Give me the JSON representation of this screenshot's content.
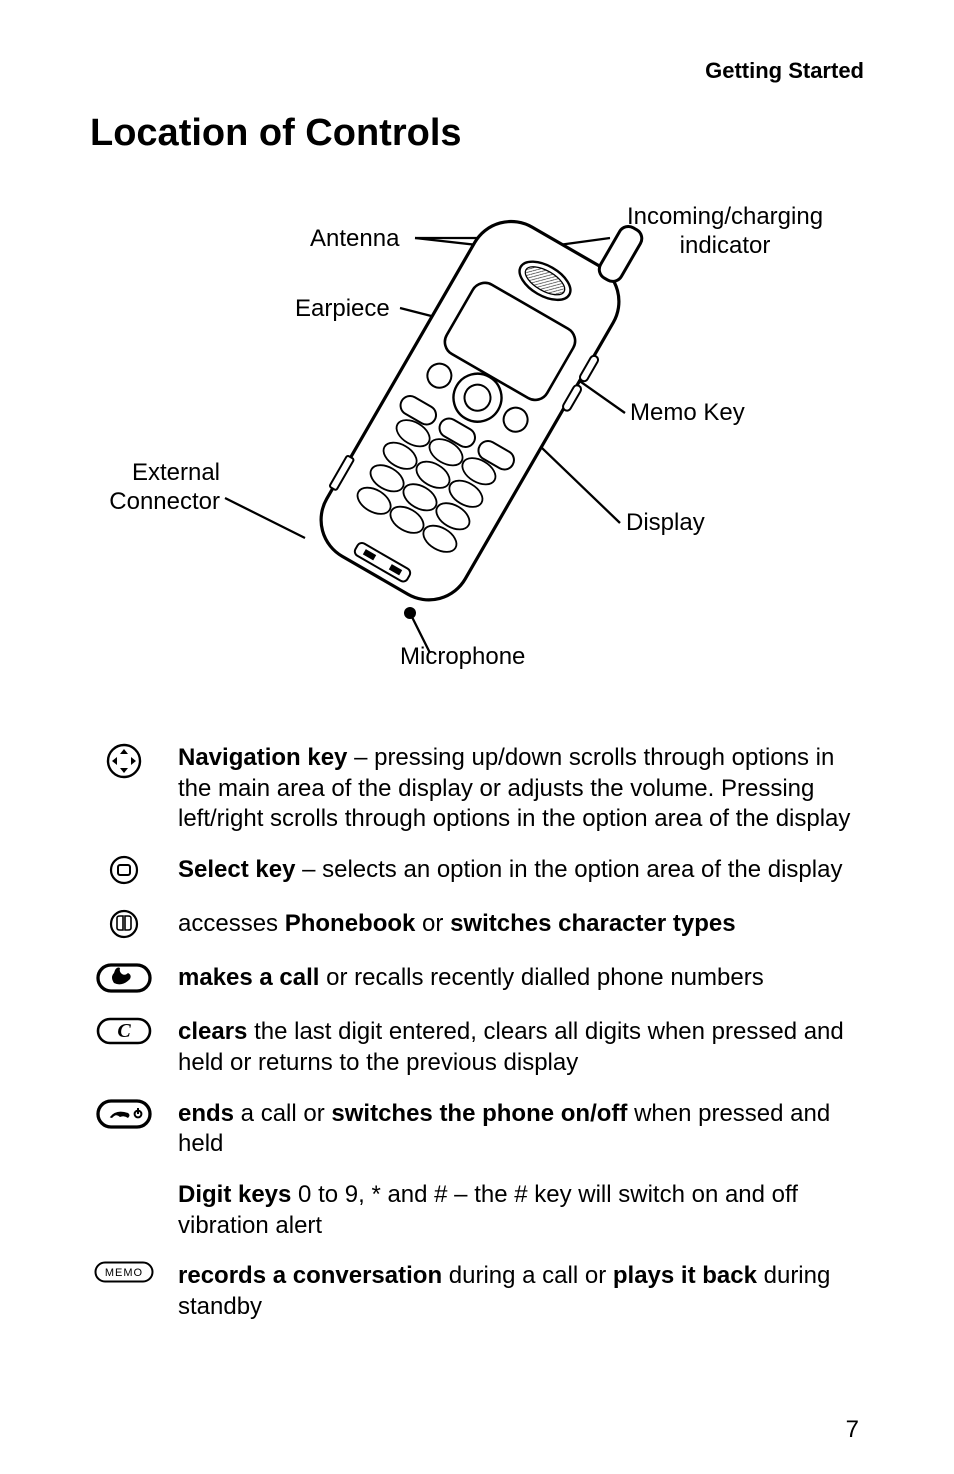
{
  "running_header": "Getting Started",
  "title": "Location of Controls",
  "diagram": {
    "labels": {
      "antenna": "Antenna",
      "incoming": "Incoming/charging indicator",
      "earpiece": "Earpiece",
      "memokey": "Memo Key",
      "external": "External Connector",
      "display": "Display",
      "microphone": "Microphone"
    }
  },
  "descriptions": [
    {
      "icon": "nav-circle-icon",
      "parts": [
        {
          "b": true,
          "t": "Navigation key"
        },
        {
          "b": false,
          "t": " – pressing up/down scrolls through options in the main area of the display or adjusts the volume. Pressing left/right scrolls through options in the option area of the display"
        }
      ]
    },
    {
      "icon": "select-circle-icon",
      "parts": [
        {
          "b": true,
          "t": "Select key"
        },
        {
          "b": false,
          "t": " – selects an option in the option area of the display"
        }
      ]
    },
    {
      "icon": "phonebook-icon",
      "parts": [
        {
          "b": false,
          "t": "accesses "
        },
        {
          "b": true,
          "t": "Phonebook"
        },
        {
          "b": false,
          "t": " or "
        },
        {
          "b": true,
          "t": "switches character types"
        }
      ]
    },
    {
      "icon": "call-pill-icon",
      "parts": [
        {
          "b": true,
          "t": "makes a call"
        },
        {
          "b": false,
          "t": " or recalls recently dialled phone numbers"
        }
      ]
    },
    {
      "icon": "clear-pill-icon",
      "parts": [
        {
          "b": true,
          "t": "clears"
        },
        {
          "b": false,
          "t": " the last digit entered, clears all digits when pressed and held or returns to the previous display"
        }
      ]
    },
    {
      "icon": "end-pill-icon",
      "parts": [
        {
          "b": true,
          "t": "ends"
        },
        {
          "b": false,
          "t": " a call or "
        },
        {
          "b": true,
          "t": "switches the phone on/off"
        },
        {
          "b": false,
          "t": " when pressed and held"
        }
      ]
    },
    {
      "icon": "none",
      "parts": [
        {
          "b": true,
          "t": "Digit keys"
        },
        {
          "b": false,
          "t": " 0 to 9, * and # – the # key will switch on and off vibration alert"
        }
      ]
    },
    {
      "icon": "memo-pill-icon",
      "parts": [
        {
          "b": true,
          "t": "records a conversation"
        },
        {
          "b": false,
          "t": " during a call or "
        },
        {
          "b": true,
          "t": "plays it back"
        },
        {
          "b": false,
          "t": " during standby"
        }
      ]
    }
  ],
  "page_number": "7"
}
